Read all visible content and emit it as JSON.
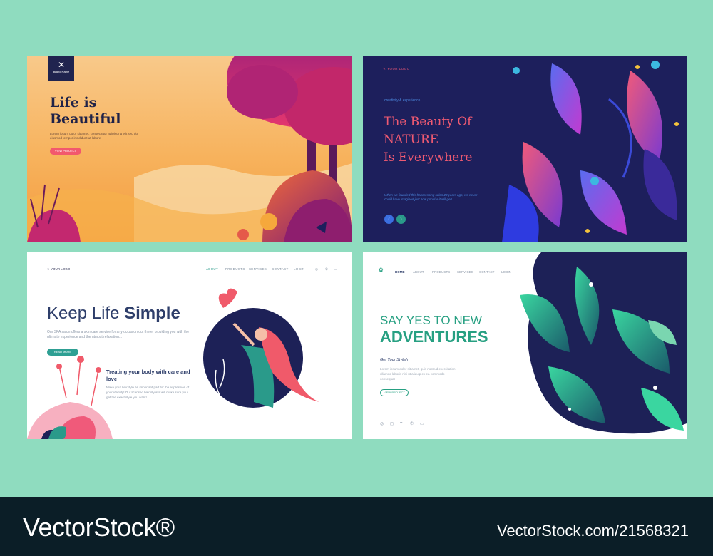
{
  "card1": {
    "brand_name": "Brand Name",
    "title": "Life is Beautiful",
    "text": "Lorem ipsum dolor sit amet, consectetur adipiscing elit sed do eiusmod tempor incididunt ut labore",
    "button": "VIEW PROJECT"
  },
  "card2": {
    "logo": "YOUR LOGO",
    "tagline": "creativity & experience",
    "title_line1": "The Beauty Of",
    "title_line2": "NATURE",
    "title_line3": "Is Everywhere",
    "text": "When we founded this hairdressing salon 20 years ago, we never could have imagined just how popular it will get!",
    "prev": "‹",
    "next": "›"
  },
  "card3": {
    "logo": "YOUR LOGO",
    "nav": [
      "ABOUT",
      "PRODUCTS",
      "SERVICES",
      "CONTACT",
      "LOGIN"
    ],
    "title_light": "Keep Life ",
    "title_bold": "Simple",
    "text": "Our SPA salon offers a skin care service for any occasion out there, providing you with the ultimate experience and the utmost relaxation...",
    "button": "READ MORE",
    "subtitle": "Treating your body with care and love",
    "text2": "Make your hairstyle an important part for the expression of your identity! Our licensed hair stylists will make sure you get the exact style you want!"
  },
  "card4": {
    "nav": [
      "HOME",
      "ABOUT",
      "PRODUCTS",
      "SERVICES",
      "CONTACT",
      "LOGIN"
    ],
    "title_line1": "SAY YES TO NEW",
    "title_line2": "ADVENTURES",
    "subtitle": "Get Your Stylish",
    "text": "Lorem ipsum dolor sit amet, quis nostrud exercitation ullamco laboris nisi ut aliquip ex ea commodo consequat",
    "button": "VIEW PROJECT"
  },
  "footer": {
    "brand": "VectorStock®",
    "id": "VectorStock.com/21568321"
  },
  "colors": {
    "background": "#8fdcbf",
    "navy": "#1d1f5c",
    "coral": "#ef5a72",
    "teal": "#27a082",
    "footer": "#0b1e27"
  }
}
